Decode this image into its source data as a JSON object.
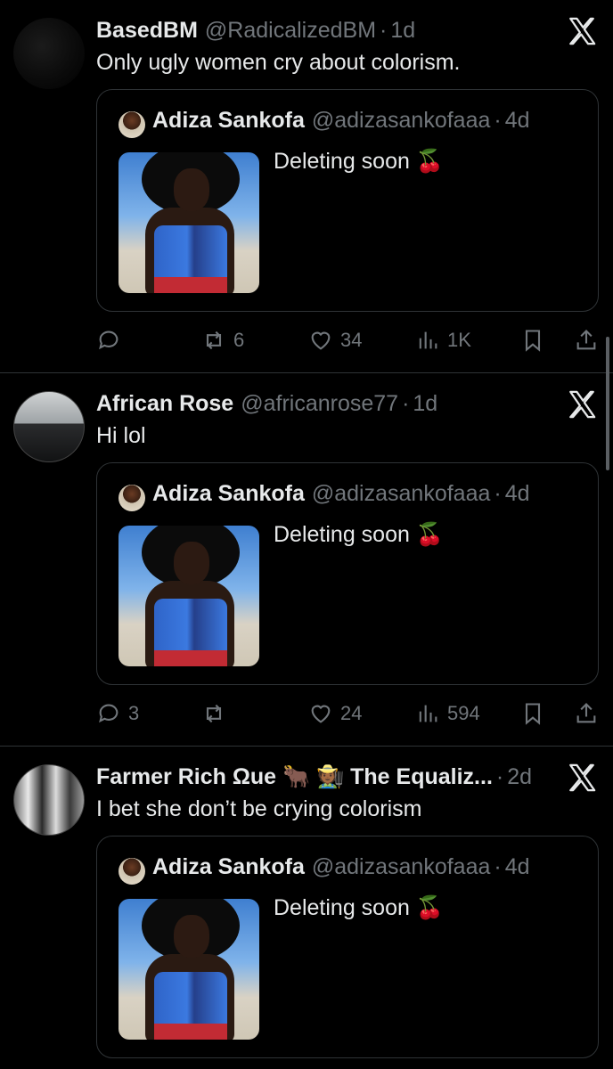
{
  "tweets": [
    {
      "name": "BasedBM",
      "handle": "@RadicalizedBM",
      "time": "1d",
      "text": "Only ugly women cry about colorism.",
      "quote": {
        "name": "Adiza Sankofa",
        "handle": "@adizasankofaaa",
        "time": "4d",
        "text": "Deleting soon 🍒"
      },
      "actions": {
        "replies": "",
        "reposts": "6",
        "likes": "34",
        "views": "1K"
      }
    },
    {
      "name": "African Rose",
      "handle": "@africanrose77",
      "time": "1d",
      "text": "Hi lol",
      "quote": {
        "name": "Adiza Sankofa",
        "handle": "@adizasankofaaa",
        "time": "4d",
        "text": "Deleting soon 🍒"
      },
      "actions": {
        "replies": "3",
        "reposts": "",
        "likes": "24",
        "views": "594"
      }
    },
    {
      "name": "Farmer Rich Ωue 🐂 🧑🏾‍🌾 The Equaliz...",
      "handle": "",
      "time": "2d",
      "text": "I bet she don’t be crying colorism",
      "quote": {
        "name": "Adiza Sankofa",
        "handle": "@adizasankofaaa",
        "time": "4d",
        "text": "Deleting soon 🍒"
      }
    }
  ],
  "colors": {
    "background": "#000000",
    "text": "#e7e9ea",
    "muted": "#71767b",
    "border": "#2f3336"
  },
  "icons": [
    "x-logo-icon",
    "reply-icon",
    "repost-icon",
    "like-icon",
    "views-icon",
    "bookmark-icon",
    "share-icon"
  ]
}
